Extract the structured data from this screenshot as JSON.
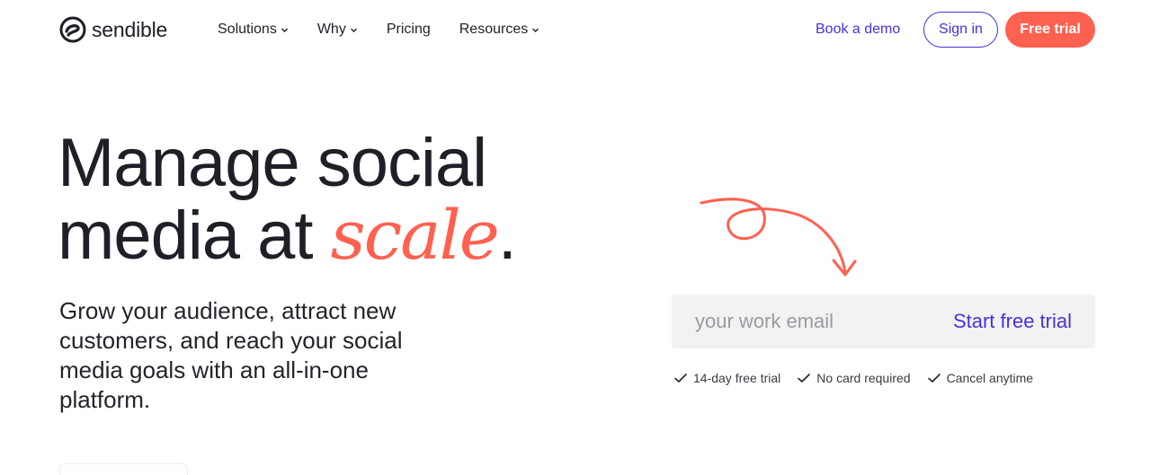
{
  "nav": {
    "logo_text": "sendible",
    "menu": [
      {
        "label": "Solutions",
        "has_dropdown": true
      },
      {
        "label": "Why",
        "has_dropdown": true
      },
      {
        "label": "Pricing",
        "has_dropdown": false
      },
      {
        "label": "Resources",
        "has_dropdown": true
      }
    ],
    "book_demo": "Book a demo",
    "sign_in": "Sign in",
    "free_trial": "Free trial"
  },
  "hero": {
    "headline_line1": "Manage social",
    "headline_line2_prefix": "media at ",
    "headline_accent": "scale",
    "headline_suffix": ".",
    "subheadline": "Grow your audience, attract new customers, and reach your social media goals with an all-in-one platform."
  },
  "signup": {
    "email_placeholder": "your work email",
    "email_value": "",
    "cta": "Start free trial",
    "benefits": [
      "14-day free trial",
      "No card required",
      "Cancel anytime"
    ]
  },
  "colors": {
    "brand_purple": "#4a2fd8",
    "brand_coral": "#ff6150",
    "text_dark": "#1f1f27",
    "input_bg": "#f2f2f3"
  },
  "icons": {
    "logo": "sendible-logo-mark",
    "dropdown": "chevron-down-icon",
    "arrow": "curly-arrow-doodle",
    "check": "check-icon"
  }
}
